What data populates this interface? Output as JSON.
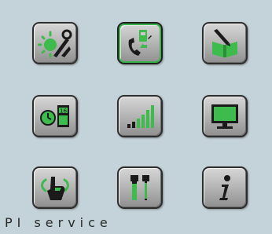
{
  "menu": {
    "items": [
      {
        "icon": "sun-tools-icon"
      },
      {
        "icon": "phone-service-icon",
        "selected": true
      },
      {
        "icon": "book-edit-icon"
      },
      {
        "icon": "clock-calendar-icon",
        "calendar_day": "16"
      },
      {
        "icon": "signal-bars-icon"
      },
      {
        "icon": "monitor-icon"
      },
      {
        "icon": "touch-hand-icon"
      },
      {
        "icon": "service-tools-icon"
      },
      {
        "icon": "info-icon"
      }
    ]
  },
  "status": {
    "label": "PI service"
  },
  "colors": {
    "background": "#c4d3d9",
    "accent_green": "#38b34a",
    "tile_border": "#2d2d2d"
  }
}
